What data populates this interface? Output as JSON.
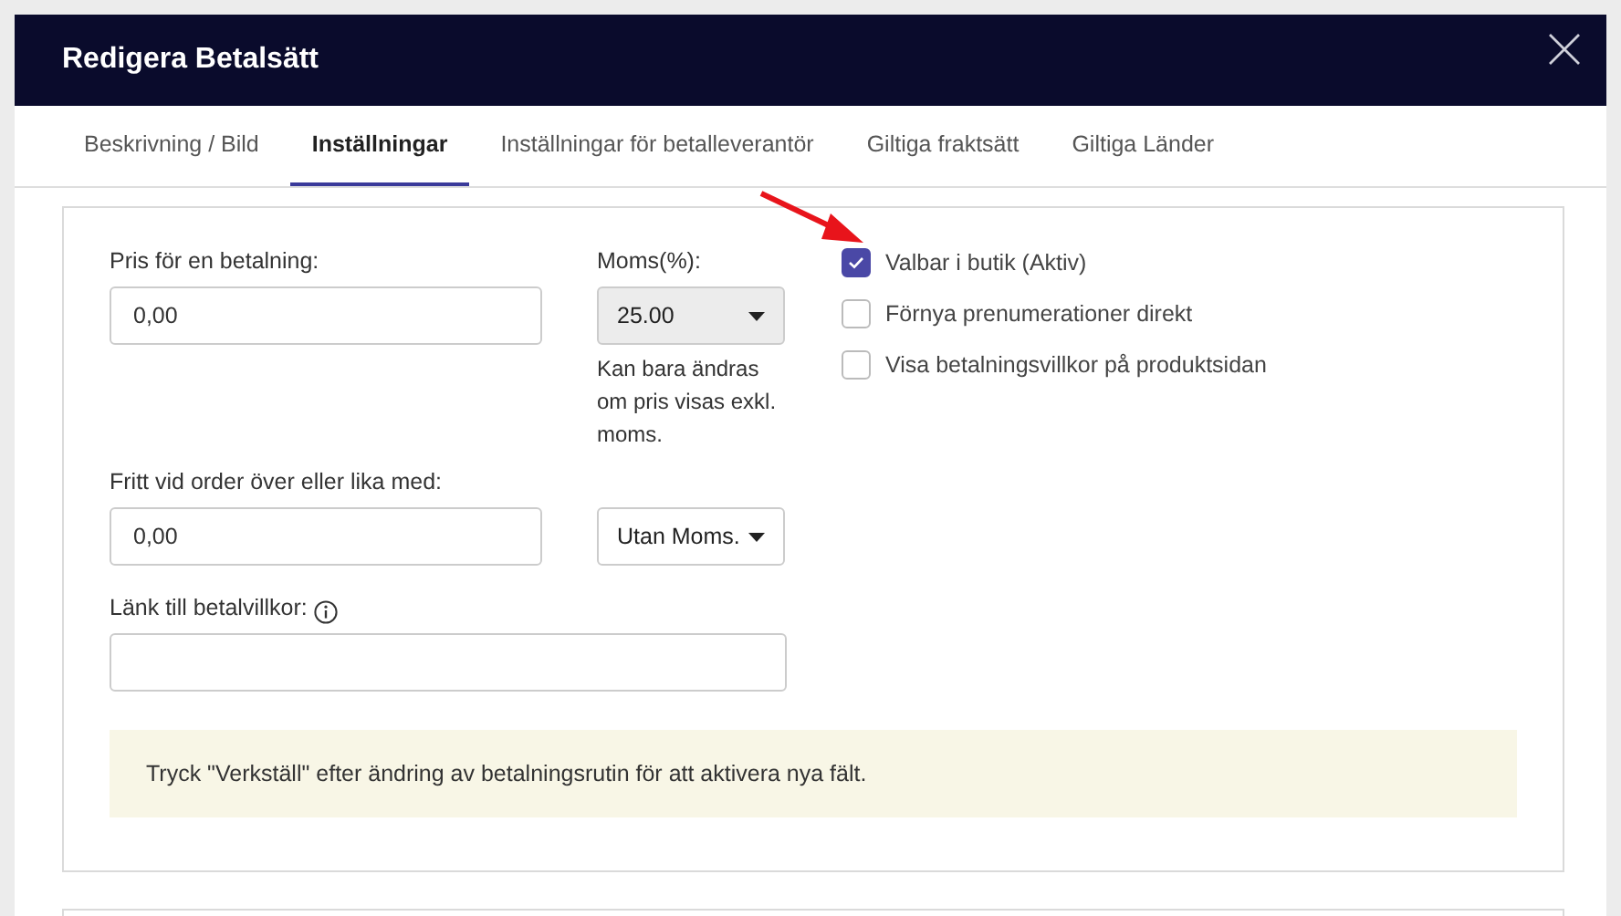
{
  "dialog": {
    "title": "Redigera Betalsätt"
  },
  "tabs": [
    {
      "label": "Beskrivning / Bild",
      "selected": false
    },
    {
      "label": "Inställningar",
      "selected": true
    },
    {
      "label": "Inställningar för betalleverantör",
      "selected": false
    },
    {
      "label": "Giltiga fraktsätt",
      "selected": false
    },
    {
      "label": "Giltiga Länder",
      "selected": false
    }
  ],
  "price": {
    "label": "Pris för en betalning:",
    "value": "0,00"
  },
  "vat": {
    "label": "Moms(%):",
    "value": "25.00",
    "disabled": true,
    "note": "Kan bara ändras om pris visas exkl. moms."
  },
  "free_shipping": {
    "label": "Fritt vid order över eller lika med:",
    "value": "0,00",
    "tax_select": "Utan Moms."
  },
  "terms_link": {
    "label": "Länk till betalvillkor:"
  },
  "options": [
    {
      "label": "Valbar i butik (Aktiv)",
      "checked": true
    },
    {
      "label": "Förnya prenumerationer direkt",
      "checked": false
    },
    {
      "label": "Visa betalningsvillkor på produktsidan",
      "checked": false
    }
  ],
  "notice": "Tryck \"Verkställ\" efter ändring av betalningsrutin för att aktivera nya fält."
}
